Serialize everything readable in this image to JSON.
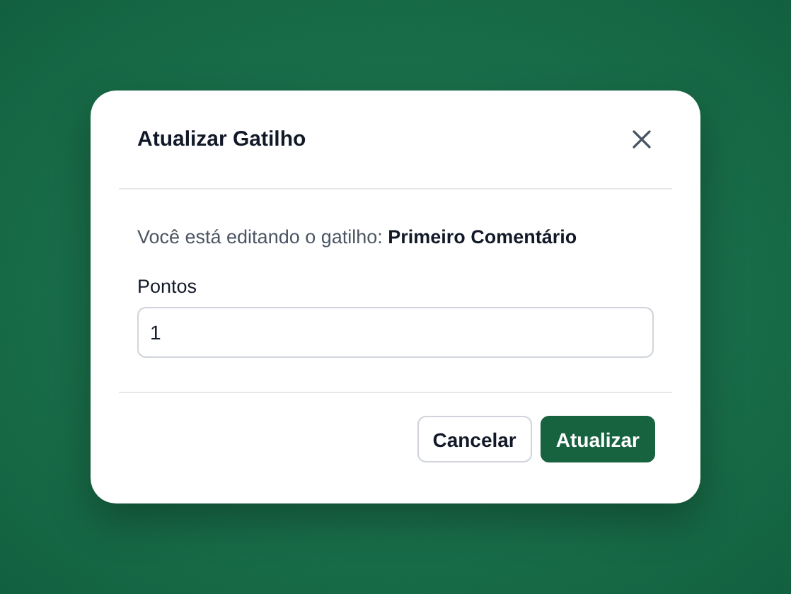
{
  "dialog": {
    "title": "Atualizar Gatilho",
    "message": "Você está editando o gatilho: **Primeiro Comentário**",
    "field": {
      "label": "Pontos",
      "value": "1"
    },
    "buttons": [
      {
        "label": "Cancelar",
        "kind": "secondary"
      },
      {
        "label": "Atualizar",
        "kind": "primary"
      }
    ]
  }
}
